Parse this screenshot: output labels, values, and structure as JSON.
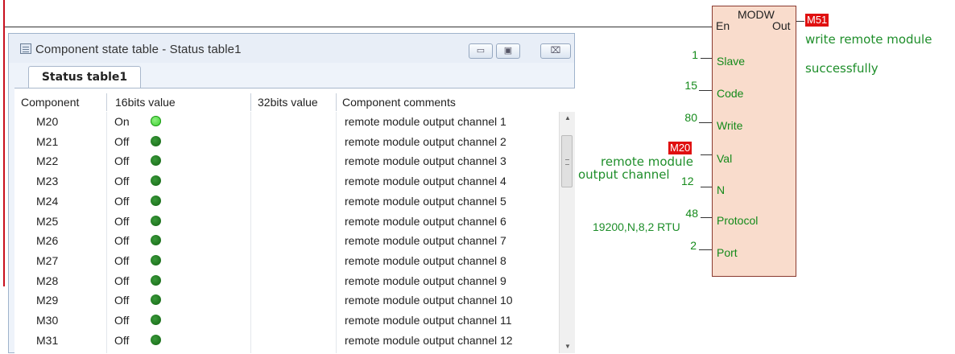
{
  "window": {
    "title": "Component state table - Status table1",
    "buttons": {
      "minimize": "▭",
      "maximize": "▣",
      "close": "⌧"
    },
    "tab": "Status table1"
  },
  "table": {
    "columns": [
      "Component",
      "16bits value",
      "32bits value",
      "Component comments"
    ],
    "rows": [
      {
        "component": "M20",
        "value16": "On",
        "state": "on",
        "value32": "",
        "comment": "remote module output channel 1"
      },
      {
        "component": "M21",
        "value16": "Off",
        "state": "off",
        "value32": "",
        "comment": "remote module output channel 2"
      },
      {
        "component": "M22",
        "value16": "Off",
        "state": "off",
        "value32": "",
        "comment": "remote module output channel 3"
      },
      {
        "component": "M23",
        "value16": "Off",
        "state": "off",
        "value32": "",
        "comment": "remote module output channel 4"
      },
      {
        "component": "M24",
        "value16": "Off",
        "state": "off",
        "value32": "",
        "comment": "remote module output channel 5"
      },
      {
        "component": "M25",
        "value16": "Off",
        "state": "off",
        "value32": "",
        "comment": "remote module output channel 6"
      },
      {
        "component": "M26",
        "value16": "Off",
        "state": "off",
        "value32": "",
        "comment": "remote module output channel 7"
      },
      {
        "component": "M27",
        "value16": "Off",
        "state": "off",
        "value32": "",
        "comment": "remote module output channel 8"
      },
      {
        "component": "M28",
        "value16": "Off",
        "state": "off",
        "value32": "",
        "comment": "remote module output channel 9"
      },
      {
        "component": "M29",
        "value16": "Off",
        "state": "off",
        "value32": "",
        "comment": "remote module output channel 10"
      },
      {
        "component": "M30",
        "value16": "Off",
        "state": "off",
        "value32": "",
        "comment": "remote module output channel 11"
      },
      {
        "component": "M31",
        "value16": "Off",
        "state": "off",
        "value32": "",
        "comment": "remote module output channel 12"
      }
    ]
  },
  "block": {
    "name": "MODW",
    "en": "En",
    "out": "Out",
    "out_tag": "M51",
    "out_note_1": "write remote module",
    "out_note_2": "successfully",
    "pins": {
      "slave": {
        "label": "Slave",
        "value": "1"
      },
      "code": {
        "label": "Code",
        "value": "15"
      },
      "write": {
        "label": "Write",
        "value": "80"
      },
      "val": {
        "label": "Val",
        "tag": "M20",
        "note": "remote module"
      },
      "n": {
        "label": "N",
        "value": "12",
        "note": "output channel"
      },
      "protocol": {
        "label": "Protocol",
        "value": "48",
        "note": "19200,N,8,2 RTU"
      },
      "port": {
        "label": "Port",
        "value": "2"
      }
    }
  },
  "colors": {
    "on_led": "#34d12a",
    "off_led": "#136413",
    "tag": "#e01010",
    "block_fill": "#f9dccc",
    "note": "#1e8e2a"
  }
}
